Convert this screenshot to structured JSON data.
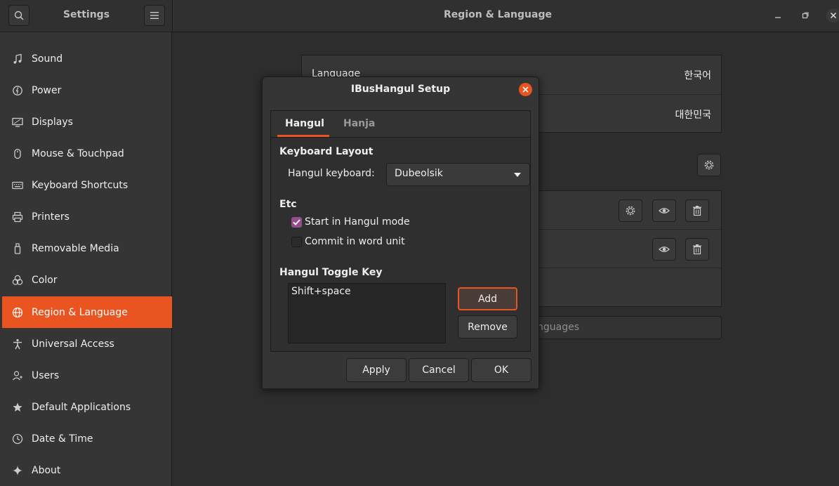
{
  "header": {
    "app_title": "Settings",
    "panel_title": "Region & Language"
  },
  "sidebar": {
    "items": [
      {
        "label": "Sound",
        "icon": "music-note-icon"
      },
      {
        "label": "Power",
        "icon": "power-icon"
      },
      {
        "label": "Displays",
        "icon": "display-icon"
      },
      {
        "label": "Mouse & Touchpad",
        "icon": "mouse-icon"
      },
      {
        "label": "Keyboard Shortcuts",
        "icon": "keyboard-icon"
      },
      {
        "label": "Printers",
        "icon": "printer-icon"
      },
      {
        "label": "Removable Media",
        "icon": "usb-drive-icon"
      },
      {
        "label": "Color",
        "icon": "color-icon"
      },
      {
        "label": "Region & Language",
        "icon": "globe-icon",
        "active": true
      },
      {
        "label": "Universal Access",
        "icon": "accessibility-icon"
      },
      {
        "label": "Users",
        "icon": "users-icon"
      },
      {
        "label": "Default Applications",
        "icon": "star-icon"
      },
      {
        "label": "Date & Time",
        "icon": "clock-icon"
      },
      {
        "label": "About",
        "icon": "sparkle-icon"
      }
    ]
  },
  "region": {
    "language_label": "Language",
    "language_value": "한국어",
    "formats_value": "대한민국",
    "manage_languages_partial": "nguages"
  },
  "dialog": {
    "title": "IBusHangul Setup",
    "tabs": [
      "Hangul",
      "Hanja"
    ],
    "keyboard_layout_heading": "Keyboard Layout",
    "hangul_keyboard_label": "Hangul keyboard:",
    "hangul_keyboard_value": "Dubeolsik",
    "etc_heading": "Etc",
    "start_in_hangul_mode": "Start in Hangul mode",
    "start_in_hangul_mode_checked": true,
    "commit_in_word_unit": "Commit in word unit",
    "commit_in_word_unit_checked": false,
    "toggle_key_heading": "Hangul Toggle Key",
    "toggle_keys": [
      "Shift+space"
    ],
    "add_label": "Add",
    "remove_label": "Remove",
    "apply_label": "Apply",
    "cancel_label": "Cancel",
    "ok_label": "OK"
  },
  "colors": {
    "accent": "#e95420",
    "checkbox": "#924d8b"
  }
}
